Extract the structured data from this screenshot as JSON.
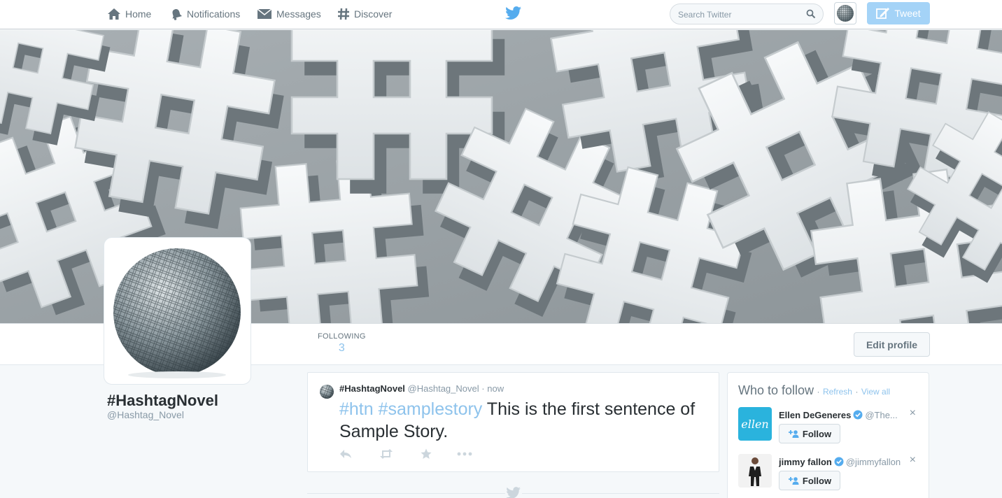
{
  "nav": {
    "home": "Home",
    "notifications": "Notifications",
    "messages": "Messages",
    "discover": "Discover",
    "search_placeholder": "Search Twitter",
    "tweet_button": "Tweet"
  },
  "profile": {
    "name": "#HashtagNovel",
    "handle": "@Hashtag_Novel",
    "following_label": "FOLLOWING",
    "following_count": "3",
    "edit_profile": "Edit profile"
  },
  "tweet": {
    "name": "#HashtagNovel",
    "handle": "@Hashtag_Novel",
    "separator": "·",
    "time": "now",
    "hashtag1": "#htn",
    "hashtag2": "#samplestory",
    "text": "This is the first sentence of Sample Story."
  },
  "who_to_follow": {
    "title": "Who to follow",
    "separator": "·",
    "refresh": "Refresh",
    "view_all": "View all",
    "close_symbol": "×",
    "users": [
      {
        "name": "Ellen DeGeneres",
        "handle": "@The...",
        "follow": "Follow",
        "pic_text": "ellen"
      },
      {
        "name": "jimmy fallon",
        "handle": "@jimmyfallon",
        "follow": "Follow"
      }
    ]
  },
  "colors": {
    "accent": "#55acee",
    "link": "#8ec3ec",
    "tweet_button_bg": "#a4d3f7",
    "ellen_blue": "#2ab3dd"
  }
}
